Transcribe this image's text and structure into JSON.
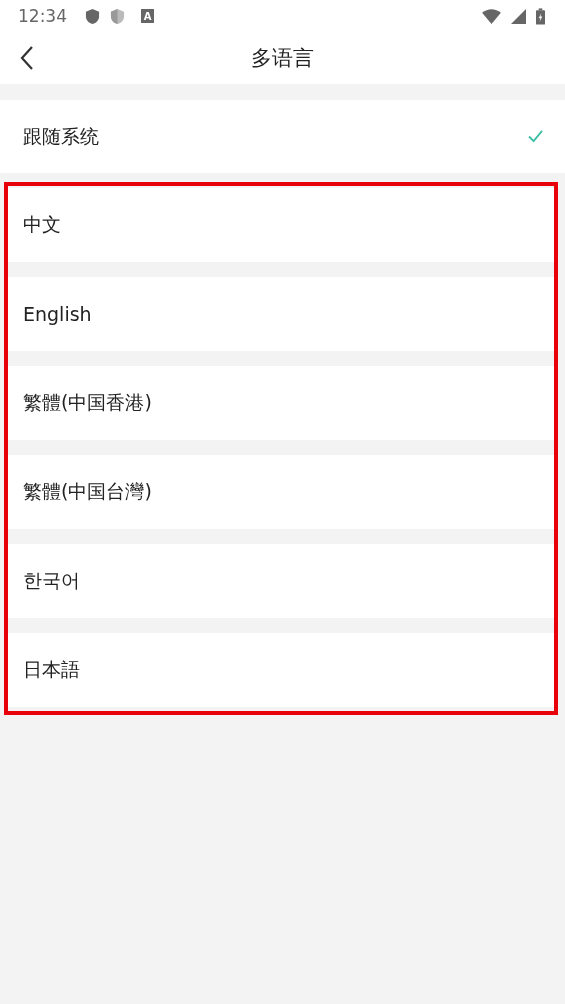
{
  "status_bar": {
    "time": "12:34",
    "notification_letter": "A"
  },
  "header": {
    "title": "多语言"
  },
  "system_option": {
    "label": "跟随系统",
    "selected": true
  },
  "languages": [
    {
      "label": "中文",
      "selected": false
    },
    {
      "label": "English",
      "selected": false
    },
    {
      "label": "繁體(中国香港)",
      "selected": false
    },
    {
      "label": "繁體(中国台灣)",
      "selected": false
    },
    {
      "label": "한국어",
      "selected": false
    },
    {
      "label": "日本語",
      "selected": false
    }
  ]
}
